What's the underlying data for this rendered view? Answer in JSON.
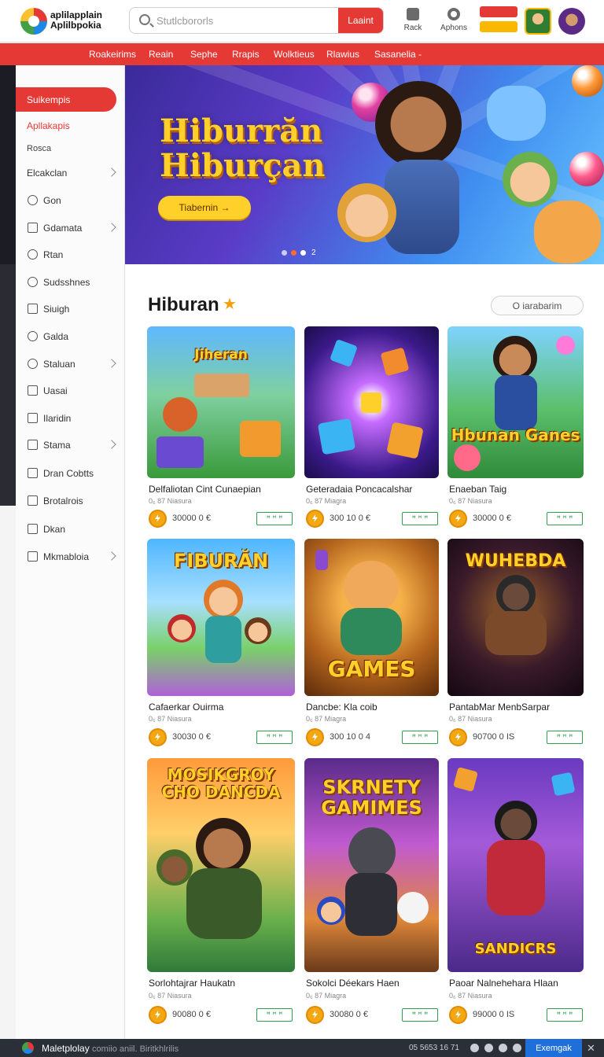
{
  "header": {
    "logo_line1": "aplilapplain",
    "logo_line2": "Aplilbpokia",
    "search_placeholder": "Stutlcbororls",
    "search_button": "Laaint",
    "tool_rack": "Rack",
    "tool_aphons": "Aphons"
  },
  "nav": [
    "Roakeirims",
    "Reain",
    "Sephe",
    "Rrapis",
    "Wolktieus",
    "Rlawius",
    "Sasanelia -"
  ],
  "sidebar": {
    "active": "Suikempis",
    "link_red": "Apllakapis",
    "link_plain": "Rosca",
    "items": [
      {
        "label": "Elcakclan",
        "icon": "none",
        "chevron": true
      },
      {
        "label": "Gon",
        "icon": "clock-icon",
        "chevron": false
      },
      {
        "label": "Gdamata",
        "icon": "checkbox-icon",
        "chevron": true
      },
      {
        "label": "Rtan",
        "icon": "clock-icon",
        "chevron": false
      },
      {
        "label": "Sudsshnes",
        "icon": "gear-icon",
        "chevron": false
      },
      {
        "label": "Siuigh",
        "icon": "checkbox-icon",
        "chevron": false
      },
      {
        "label": "Galda",
        "icon": "clock-icon",
        "chevron": false
      },
      {
        "label": "Staluan",
        "icon": "clock-icon",
        "chevron": true
      },
      {
        "label": "Uasai",
        "icon": "grid-icon",
        "chevron": false
      },
      {
        "label": "Ilaridin",
        "icon": "square-icon",
        "chevron": false
      },
      {
        "label": "Stama",
        "icon": "checkbox-icon",
        "chevron": true
      },
      {
        "label": "Dran Cobtts",
        "icon": "checkbox-icon",
        "chevron": false
      },
      {
        "label": "Brotalrois",
        "icon": "checkbox-icon",
        "chevron": false
      },
      {
        "label": "Dkan",
        "icon": "checkbox-icon",
        "chevron": false
      },
      {
        "label": "Mkmabloia",
        "icon": "checkbox-icon",
        "chevron": true
      }
    ]
  },
  "hero": {
    "title_line1": "Hiburrăn",
    "title_line2": "Hiburçan",
    "cta": "Tiabernin →",
    "slide_number": "2"
  },
  "section": {
    "title": "Hiburan",
    "view_all": "O iarabarim"
  },
  "games": [
    {
      "title": "Delfaliotan Cint Cunaepian",
      "sub": "0₆ 87 Niasura",
      "price": "30000 0 €",
      "tag": "ꟸ ꟸ ꟸ",
      "art": "Jiheran"
    },
    {
      "title": "Geteradaia Poncacalshar",
      "sub": "0₆ 87 Miagra",
      "price": "300 10 0 €",
      "tag": "ꟸ ꟸ ꟸ",
      "art": ""
    },
    {
      "title": "Enaeban Taig",
      "sub": "0₆ 87 Niasura",
      "price": "30000 0 €",
      "tag": "ꟸ ꟸ ꟸ",
      "art": "Hbunan Ganes"
    },
    {
      "title": "Cafaerkar Ouirma",
      "sub": "0₆ 87 Niasura",
      "price": "30030 0 €",
      "tag": "ꟸ ꟸ ꟸ",
      "art": "FIBURĂN"
    },
    {
      "title": "Dancbe: Kla coib",
      "sub": "0₆ 87 Miagra",
      "price": "300 10 0 4",
      "tag": "ꟸ ꟸ ꟸ",
      "art": "GAMES"
    },
    {
      "title": "PantabMar MenbSarpar",
      "sub": "0₆ 87 Niasura",
      "price": "90700 0 IS",
      "tag": "ꟸ ꟸ ꟸ",
      "art": "WUHEBDA"
    },
    {
      "title": "Sorlohtajrar Haukatn",
      "sub": "0₆ 87 Niasura",
      "price": "90080 0 €",
      "tag": "ꟸ ꟸ ꟸ",
      "art": "MOSIKGROY CHO DANCDA"
    },
    {
      "title": "Sokolci Déekars Haen",
      "sub": "0₆ 87 Miagra",
      "price": "30080 0 €",
      "tag": "ꟸ ꟸ ꟸ",
      "art": "SKRNETY GAMIMES"
    },
    {
      "title": "Paoar Nalnehehara Hlaan",
      "sub": "0₆ 87 Niasura",
      "price": "99000 0 IS",
      "tag": "ꟸ ꟸ ꟸ",
      "art": "SANDICRS"
    }
  ],
  "taskbar": {
    "app": "Maletplolay",
    "hint": "comiio aniil.  Biritkhlrilis",
    "status": "05 5653 16 71",
    "button": "Exemgak",
    "close": "✕"
  }
}
